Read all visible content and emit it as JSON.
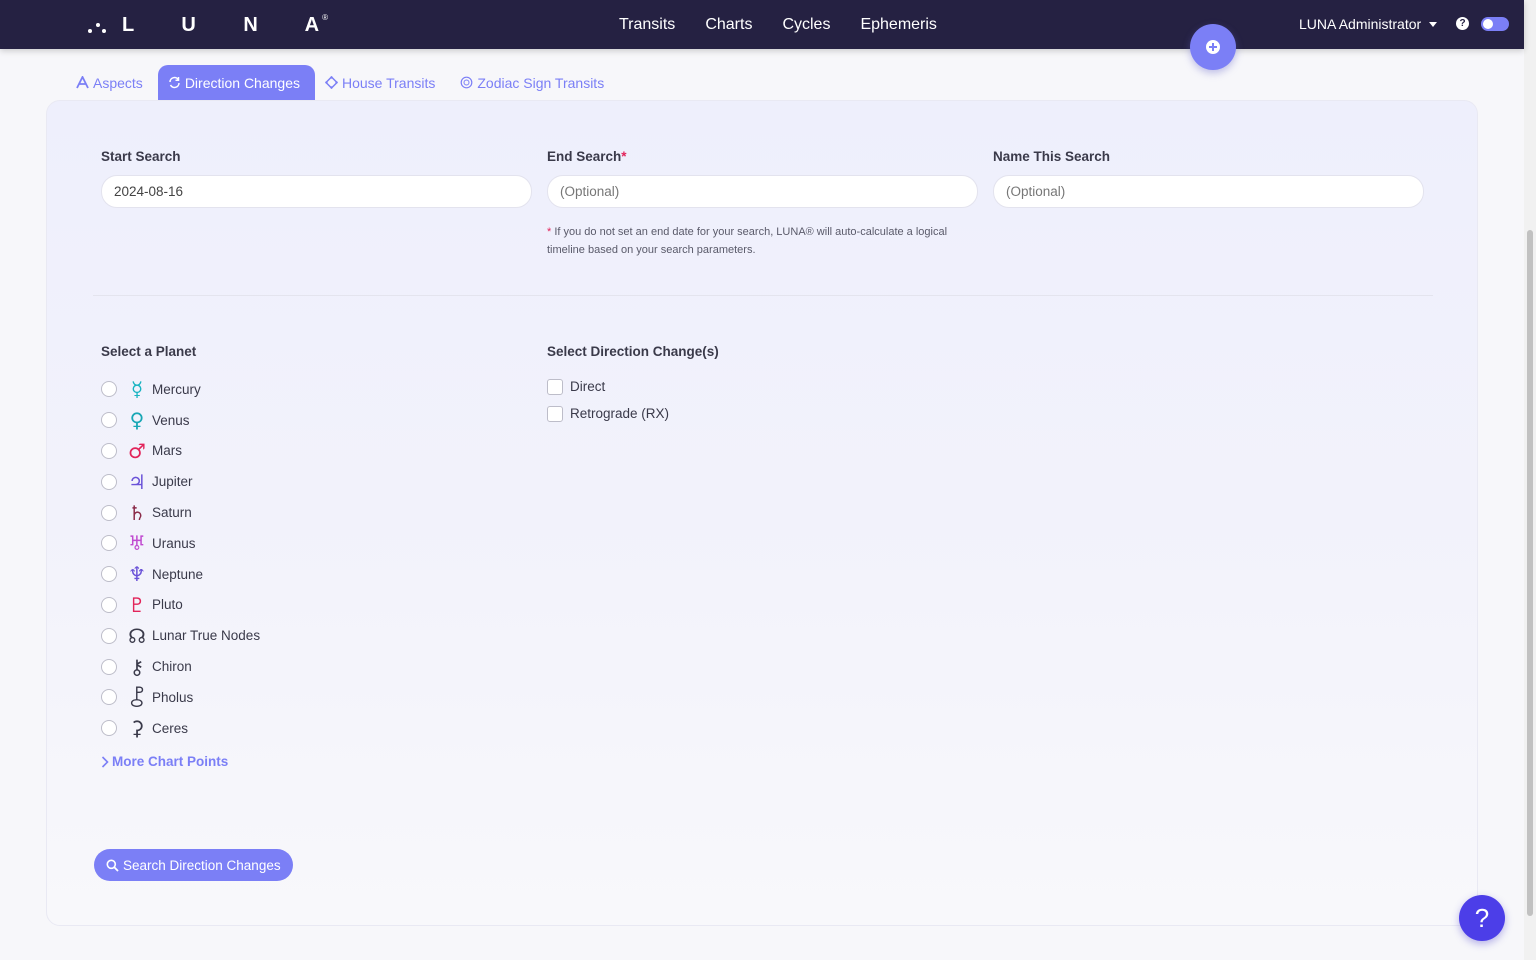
{
  "app": {
    "brand": "L U N A",
    "brand_mark": "®"
  },
  "nav": {
    "links": [
      "Transits",
      "Charts",
      "Cycles",
      "Ephemeris"
    ],
    "user": "LUNA Administrator",
    "help_glyph": "?"
  },
  "tabs": [
    {
      "label": "Aspects",
      "icon": "aspect-icon"
    },
    {
      "label": "Direction Changes",
      "icon": "refresh-icon",
      "active": true
    },
    {
      "label": "House Transits",
      "icon": "house-icon"
    },
    {
      "label": "Zodiac Sign Transits",
      "icon": "zodiac-icon"
    }
  ],
  "form": {
    "start": {
      "label": "Start Search",
      "value": "2024-08-16"
    },
    "end": {
      "label": "End Search",
      "required_mark": "*",
      "placeholder": "(Optional)"
    },
    "name": {
      "label": "Name This Search",
      "placeholder": "(Optional)"
    },
    "note_mark": "*",
    "note": " If you do not set an end date for your search, LUNA® will auto-calculate a logical timeline based on your search parameters."
  },
  "planets": {
    "label": "Select a Planet",
    "items": [
      {
        "name": "Mercury",
        "glyph": "☿",
        "color": "#18b3c1"
      },
      {
        "name": "Venus",
        "glyph": "♀",
        "color": "#18a7b5"
      },
      {
        "name": "Mars",
        "glyph": "♂",
        "color": "#e2245a"
      },
      {
        "name": "Jupiter",
        "glyph": "♃",
        "color": "#6a52d8"
      },
      {
        "name": "Saturn",
        "glyph": "♄",
        "color": "#8a2a48"
      },
      {
        "name": "Uranus",
        "glyph": "♅",
        "color": "#c04ad0"
      },
      {
        "name": "Neptune",
        "glyph": "♆",
        "color": "#6a52d8"
      },
      {
        "name": "Pluto",
        "glyph": "♇",
        "color": "#e2245a"
      },
      {
        "name": "Lunar True Nodes",
        "glyph": "☊",
        "color": "#3a3a4a"
      },
      {
        "name": "Chiron",
        "glyph": "⚷",
        "color": "#3a3a4a"
      },
      {
        "name": "Pholus",
        "glyph": "⯛",
        "color": "#3a3a4a"
      },
      {
        "name": "Ceres",
        "glyph": "⚳",
        "color": "#3a3a4a"
      }
    ],
    "more": "More Chart Points"
  },
  "directions": {
    "label": "Select Direction Change(s)",
    "items": [
      "Direct",
      "Retrograde (RX)"
    ]
  },
  "actions": {
    "search": "Search Direction Changes",
    "help": "?"
  }
}
